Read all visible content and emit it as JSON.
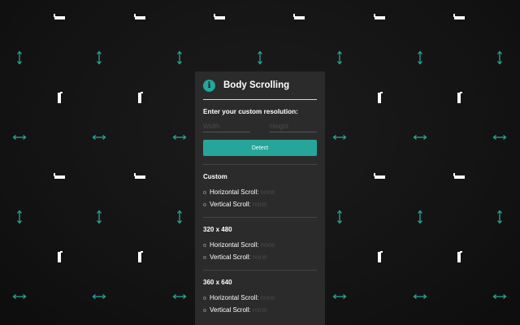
{
  "panel": {
    "title": "Body Scrolling",
    "info_icon_glyph": "i",
    "prompt": "Enter your custom resolution:",
    "width_placeholder": "Width",
    "height_placeholder": "Height",
    "detect_label": "Detect"
  },
  "sections": [
    {
      "title": "Custom",
      "horizontal_label": "Horizontal Scroll:",
      "horizontal_value": "none",
      "vertical_label": "Vertical Scroll:",
      "vertical_value": "none"
    },
    {
      "title": "320 x 480",
      "horizontal_label": "Horizontal Scroll:",
      "horizontal_value": "none",
      "vertical_label": "Vertical Scroll:",
      "vertical_value": "none"
    },
    {
      "title": "360 x 640",
      "horizontal_label": "Horizontal Scroll:",
      "horizontal_value": "none",
      "vertical_label": "Vertical Scroll:",
      "vertical_value": "none"
    }
  ],
  "colors": {
    "accent": "#26a69a",
    "panel_bg": "#2b2b2b",
    "page_bg": "#151515",
    "pattern_white": "#ffffff"
  },
  "background_icons": [
    "phone-landscape-icon",
    "vertical-arrow-icon",
    "phone-portrait-icon",
    "horizontal-arrow-icon"
  ]
}
